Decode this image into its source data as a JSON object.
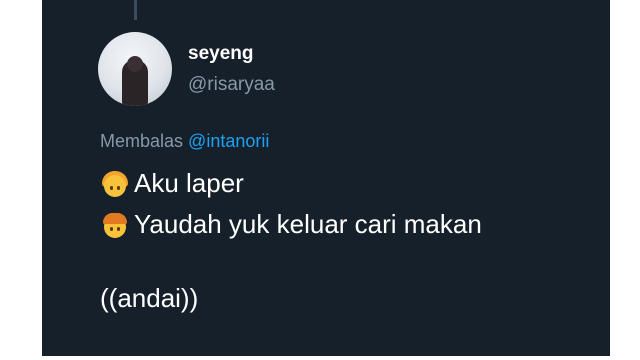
{
  "tweet": {
    "display_name": "seyeng",
    "handle": "@risaryaa",
    "reply_prefix": "Membalas",
    "reply_mention": "@intanorii",
    "lines": [
      {
        "emoji": "girl-emoji",
        "text": "Aku laper"
      },
      {
        "emoji": "boy-emoji",
        "text": "Yaudah yuk keluar cari makan"
      },
      {
        "text": "((andai))"
      }
    ]
  },
  "colors": {
    "background": "#15202b",
    "text": "#ffffff",
    "secondary": "#8899a6",
    "mention": "#1da1f2"
  }
}
